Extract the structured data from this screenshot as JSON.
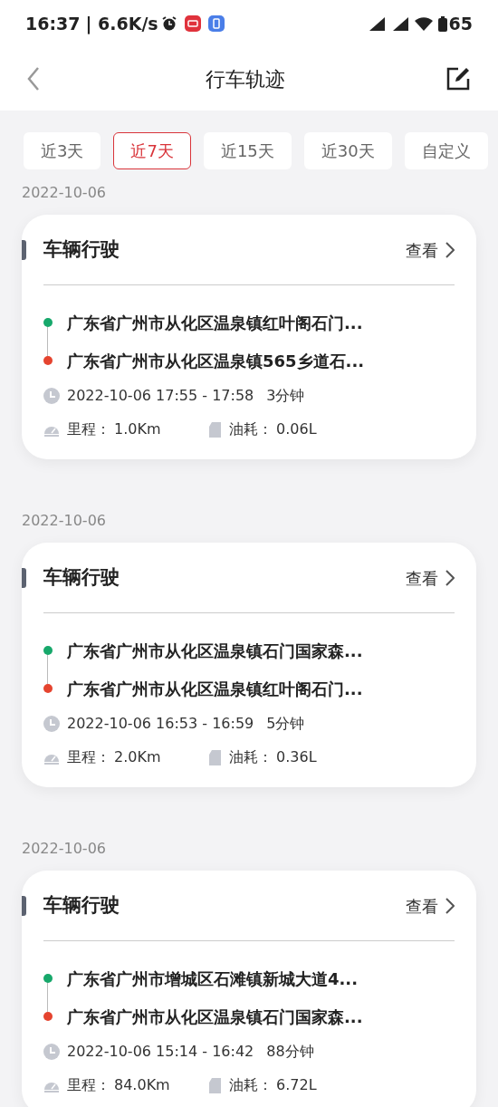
{
  "status_bar": {
    "time": "16:37",
    "speed": "| 6.6K/s",
    "battery": "65"
  },
  "header": {
    "title": "行车轨迹"
  },
  "filters": [
    {
      "label": "近3天",
      "selected": false
    },
    {
      "label": "近7天",
      "selected": true
    },
    {
      "label": "近15天",
      "selected": false
    },
    {
      "label": "近30天",
      "selected": false
    },
    {
      "label": "自定义",
      "selected": false
    }
  ],
  "trips": [
    {
      "date": "2022-10-06",
      "title": "车辆行驶",
      "action": "查看",
      "start": "广东省广州市从化区温泉镇红叶阁石门...",
      "end": "广东省广州市从化区温泉镇565乡道石...",
      "time_range": "2022-10-06 17:55 - 17:58",
      "duration": "3分钟",
      "distance_label": "里程：",
      "distance": "1.0Km",
      "fuel_label": "油耗：",
      "fuel": "0.06L"
    },
    {
      "date": "2022-10-06",
      "title": "车辆行驶",
      "action": "查看",
      "start": "广东省广州市从化区温泉镇石门国家森...",
      "end": "广东省广州市从化区温泉镇红叶阁石门...",
      "time_range": "2022-10-06 16:53 - 16:59",
      "duration": "5分钟",
      "distance_label": "里程：",
      "distance": "2.0Km",
      "fuel_label": "油耗：",
      "fuel": "0.36L"
    },
    {
      "date": "2022-10-06",
      "title": "车辆行驶",
      "action": "查看",
      "start": "广东省广州市增城区石滩镇新城大道4...",
      "end": "广东省广州市从化区温泉镇石门国家森...",
      "time_range": "2022-10-06 15:14 - 16:42",
      "duration": "88分钟",
      "distance_label": "里程：",
      "distance": "84.0Km",
      "fuel_label": "油耗：",
      "fuel": "6.72L"
    }
  ]
}
